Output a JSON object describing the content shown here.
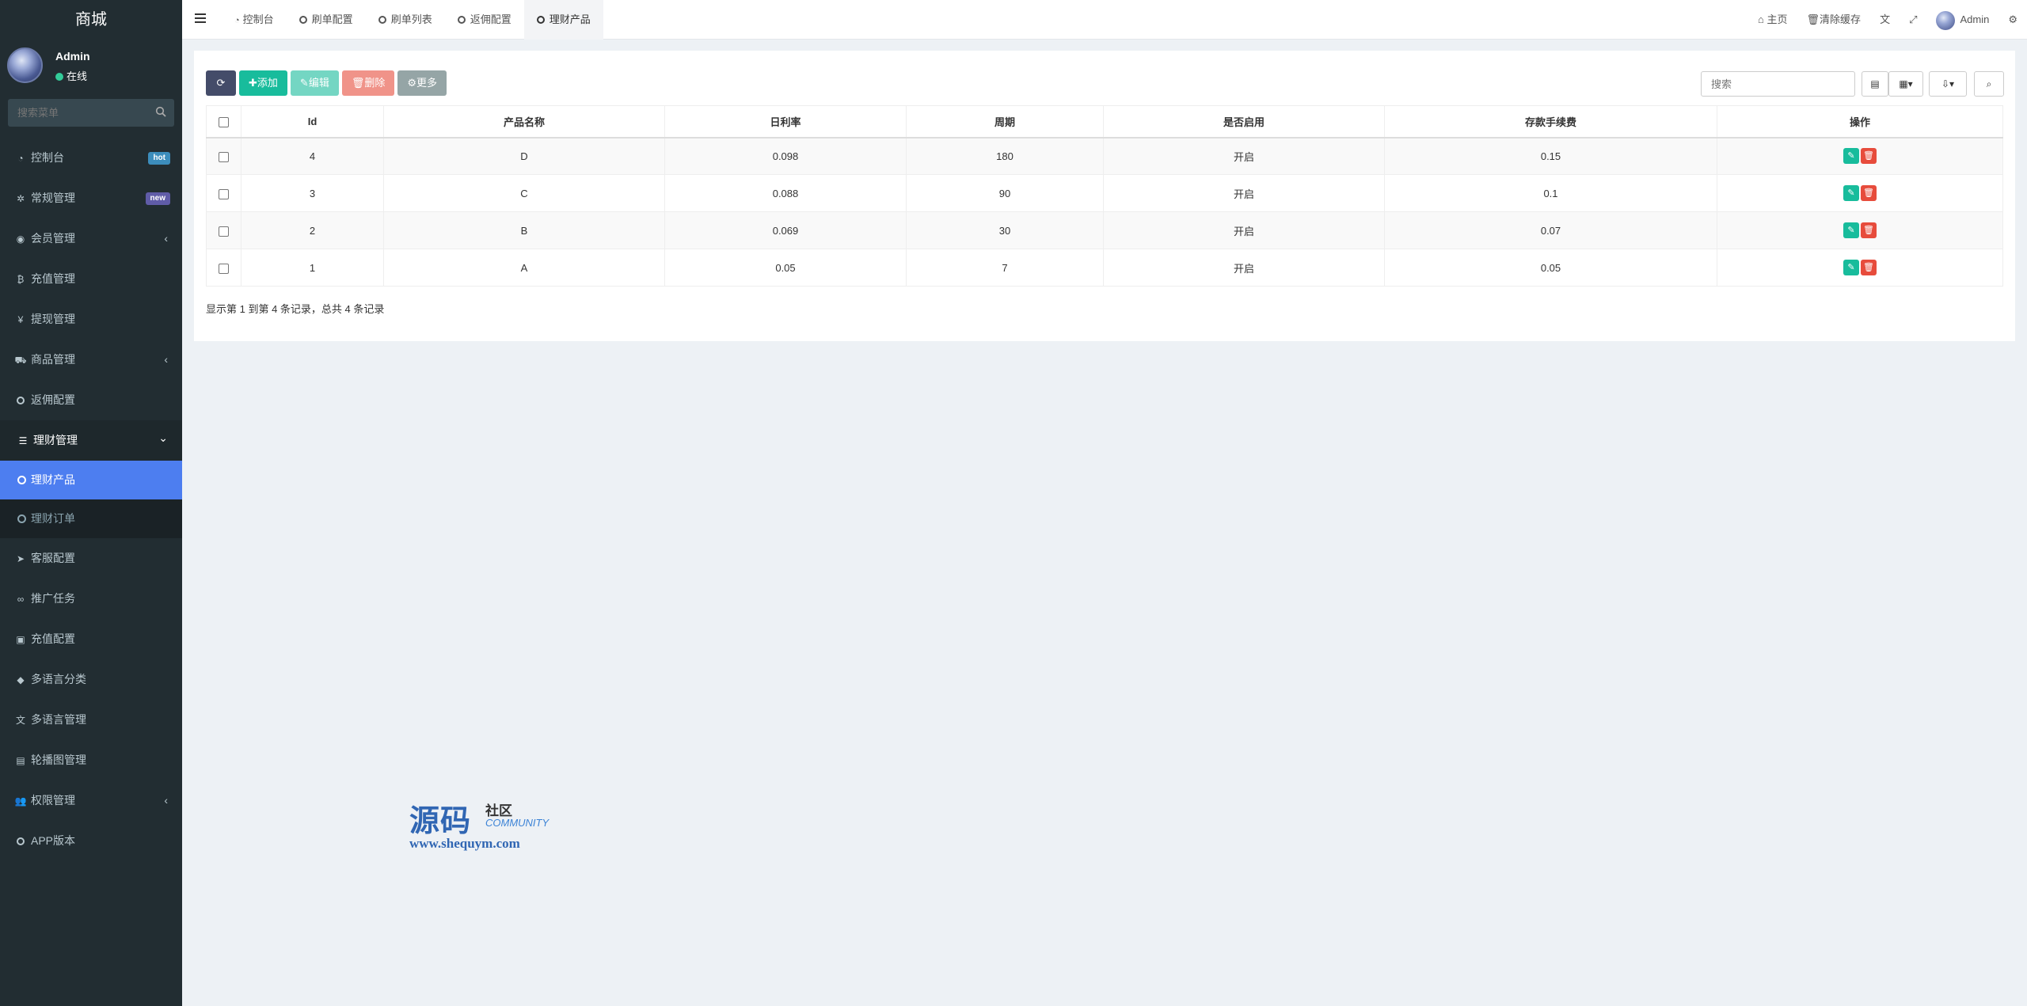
{
  "sidebar": {
    "brand": "商城",
    "user": {
      "name": "Admin",
      "status": "在线"
    },
    "search_placeholder": "搜索菜单",
    "items": [
      {
        "label": "控制台",
        "icon": "dashboard-icon",
        "badge": "hot",
        "badge_color": "#3c8dbc"
      },
      {
        "label": "常规管理",
        "icon": "cogs-icon",
        "badge": "new",
        "badge_color": "#605ca8"
      },
      {
        "label": "会员管理",
        "icon": "user-circle-icon",
        "arrow": "‹"
      },
      {
        "label": "充值管理",
        "icon": "bitcoin-icon"
      },
      {
        "label": "提现管理",
        "icon": "yen-icon"
      },
      {
        "label": "商品管理",
        "icon": "cart-icon",
        "arrow": "‹"
      },
      {
        "label": "返佣配置",
        "icon": "circle-icon"
      },
      {
        "label": "理财管理",
        "icon": "list-icon",
        "arrow": "⌄"
      },
      {
        "label": "客服配置",
        "icon": "telegram-icon"
      },
      {
        "label": "推广任务",
        "icon": "link-icon"
      },
      {
        "label": "充值配置",
        "icon": "image-icon"
      },
      {
        "label": "多语言分类",
        "icon": "tag-icon"
      },
      {
        "label": "多语言管理",
        "icon": "language-icon"
      },
      {
        "label": "轮播图管理",
        "icon": "picture-icon"
      },
      {
        "label": "权限管理",
        "icon": "group-icon",
        "arrow": "‹"
      },
      {
        "label": "APP版本",
        "icon": "circle-icon"
      }
    ],
    "sub_items": [
      {
        "label": "理财产品",
        "active": true
      },
      {
        "label": "理财订单",
        "active": false
      }
    ]
  },
  "header": {
    "tabs": [
      {
        "label": "控制台",
        "icon": "dashboard-icon"
      },
      {
        "label": "刷单配置",
        "icon": "circle-icon"
      },
      {
        "label": "刷单列表",
        "icon": "circle-icon"
      },
      {
        "label": "返佣配置",
        "icon": "circle-icon"
      },
      {
        "label": "理财产品",
        "icon": "circle-icon",
        "active": true
      }
    ],
    "right": {
      "home": "主页",
      "clear_cache": "清除缓存",
      "user": "Admin"
    }
  },
  "toolbar": {
    "add": "添加",
    "edit": "编辑",
    "delete": "删除",
    "more": "更多",
    "search_placeholder": "搜索"
  },
  "table": {
    "columns": [
      "Id",
      "产品名称",
      "日利率",
      "周期",
      "是否启用",
      "存款手续费",
      "操作"
    ],
    "rows": [
      {
        "id": "4",
        "name": "D",
        "rate": "0.098",
        "period": "180",
        "enabled": "开启",
        "fee": "0.15"
      },
      {
        "id": "3",
        "name": "C",
        "rate": "0.088",
        "period": "90",
        "enabled": "开启",
        "fee": "0.1"
      },
      {
        "id": "2",
        "name": "B",
        "rate": "0.069",
        "period": "30",
        "enabled": "开启",
        "fee": "0.07"
      },
      {
        "id": "1",
        "name": "A",
        "rate": "0.05",
        "period": "7",
        "enabled": "开启",
        "fee": "0.05"
      }
    ]
  },
  "pager_info": "显示第 1 到第 4 条记录，总共 4 条记录",
  "watermark": {
    "big": "源码",
    "small1": "社区",
    "small2": "COMMUNITY",
    "url": "www.shequym.com"
  }
}
